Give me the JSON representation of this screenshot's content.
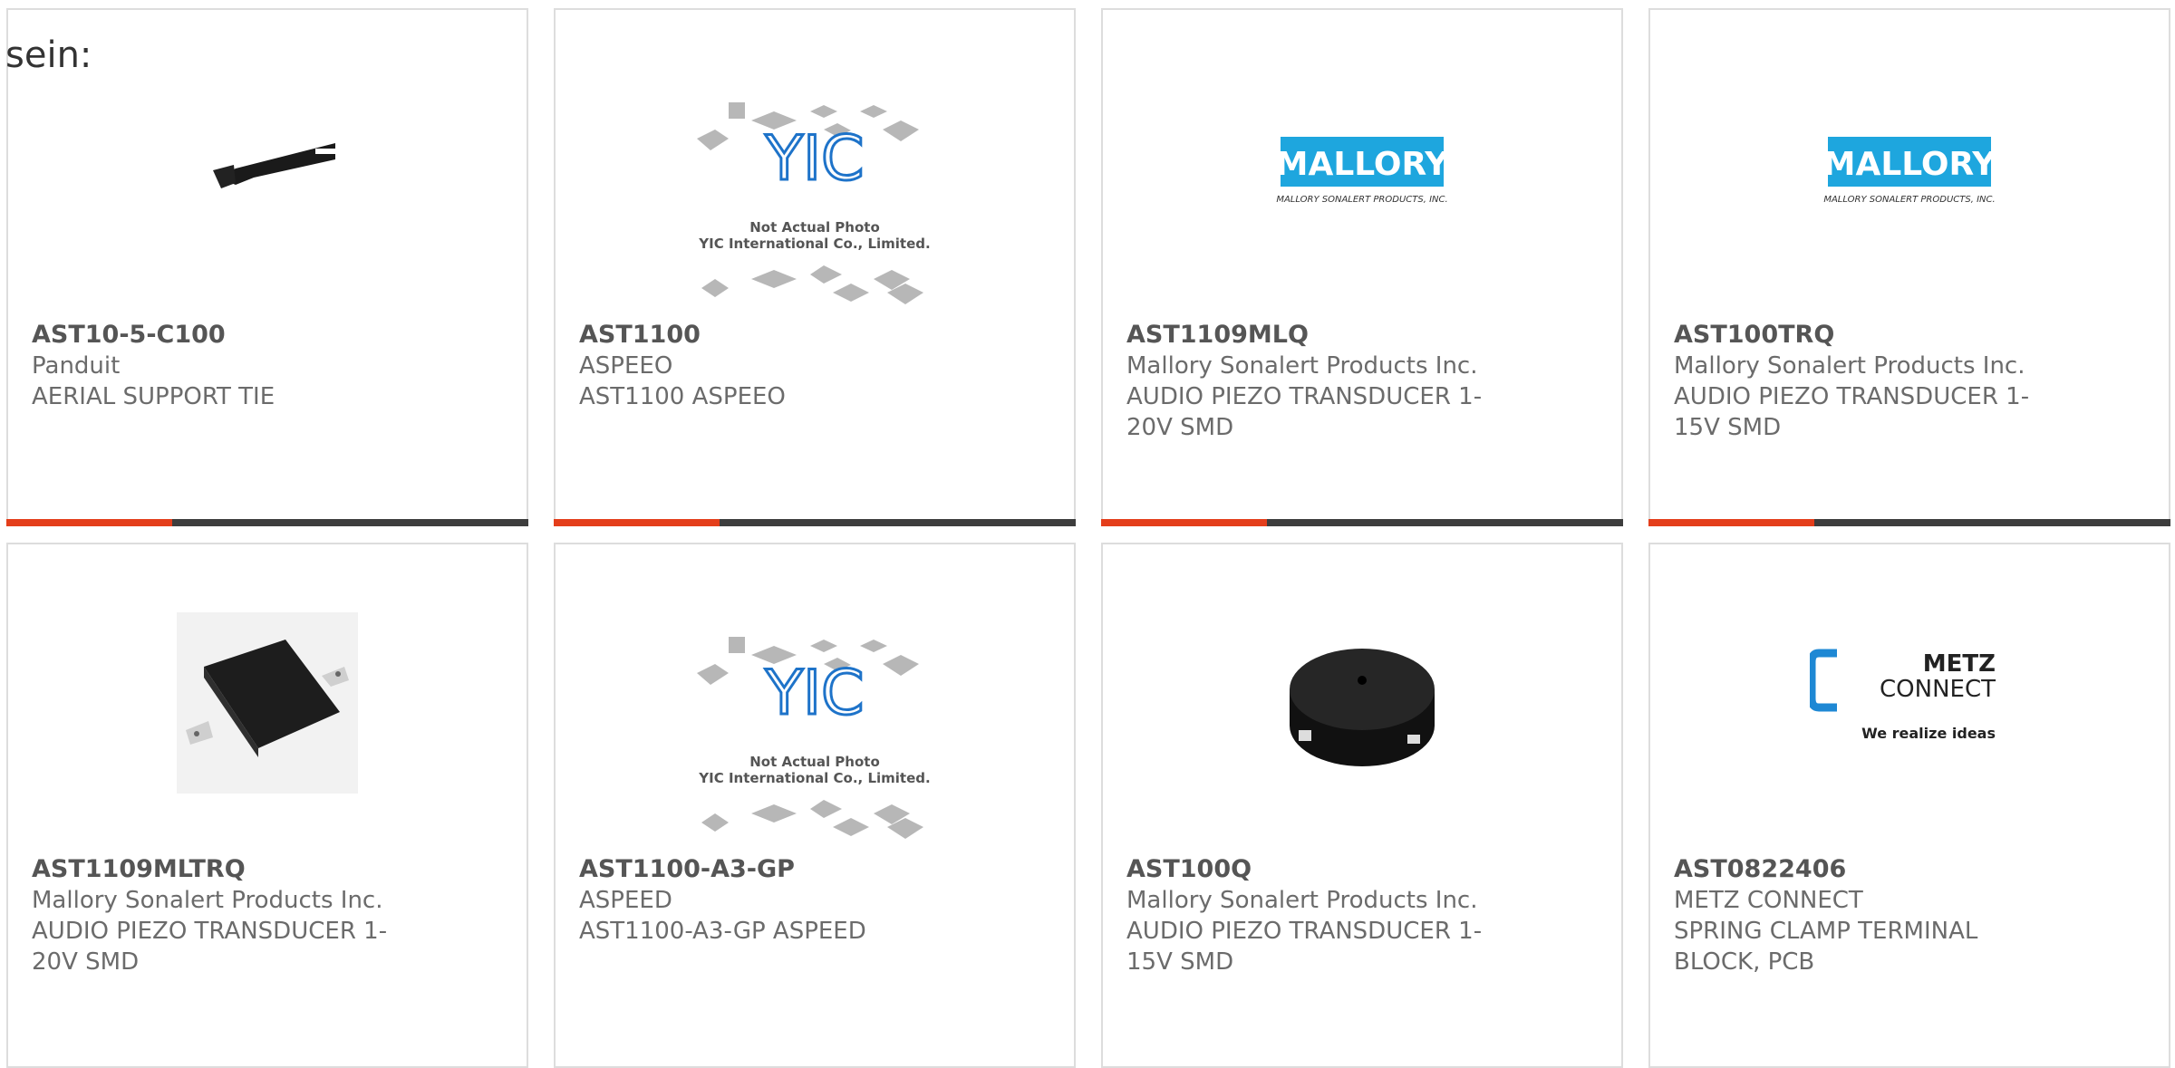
{
  "intro_text": "sein:",
  "colors": {
    "accent": "#e43e1b",
    "bar_dark": "#3d3d3d",
    "mallory_blue": "#1ea6de",
    "metz_blue": "#1e88d4"
  },
  "placeholder_image": {
    "line1": "Not Actual Photo",
    "line2": "YIC International Co., Limited.",
    "logo": "YIC"
  },
  "mallory_logo": {
    "name": "MALLORY",
    "subtitle": "MALLORY SONALERT PRODUCTS, INC."
  },
  "metz_logo": {
    "word1": "METZ",
    "word2": "CONNECT",
    "tagline": "We realize ideas"
  },
  "products": [
    {
      "part": "AST10-5-C100",
      "maker": "Panduit",
      "desc1": "AERIAL SUPPORT TIE",
      "desc2": "",
      "image": "cable-tie-image"
    },
    {
      "part": "AST1100",
      "maker": "ASPEEO",
      "desc1": "AST1100 ASPEEO",
      "desc2": "",
      "image": "placeholder-image"
    },
    {
      "part": "AST1109MLQ",
      "maker": "Mallory Sonalert Products Inc.",
      "desc1": "AUDIO PIEZO TRANSDUCER 1-",
      "desc2": "20V SMD",
      "image": "mallory-logo"
    },
    {
      "part": "AST100TRQ",
      "maker": "Mallory Sonalert Products Inc.",
      "desc1": "AUDIO PIEZO TRANSDUCER 1-",
      "desc2": "15V SMD",
      "image": "mallory-logo"
    },
    {
      "part": "AST1109MLTRQ",
      "maker": "Mallory Sonalert Products Inc.",
      "desc1": "AUDIO PIEZO TRANSDUCER 1-",
      "desc2": "20V SMD",
      "image": "piezo-square-image"
    },
    {
      "part": "AST1100-A3-GP",
      "maker": "ASPEED",
      "desc1": "AST1100-A3-GP ASPEED",
      "desc2": "",
      "image": "placeholder-image"
    },
    {
      "part": "AST100Q",
      "maker": "Mallory Sonalert Products Inc.",
      "desc1": "AUDIO PIEZO TRANSDUCER 1-",
      "desc2": "15V SMD",
      "image": "piezo-round-image"
    },
    {
      "part": "AST0822406",
      "maker": "METZ CONNECT",
      "desc1": "SPRING CLAMP TERMINAL",
      "desc2": "BLOCK, PCB",
      "image": "metz-logo"
    }
  ]
}
